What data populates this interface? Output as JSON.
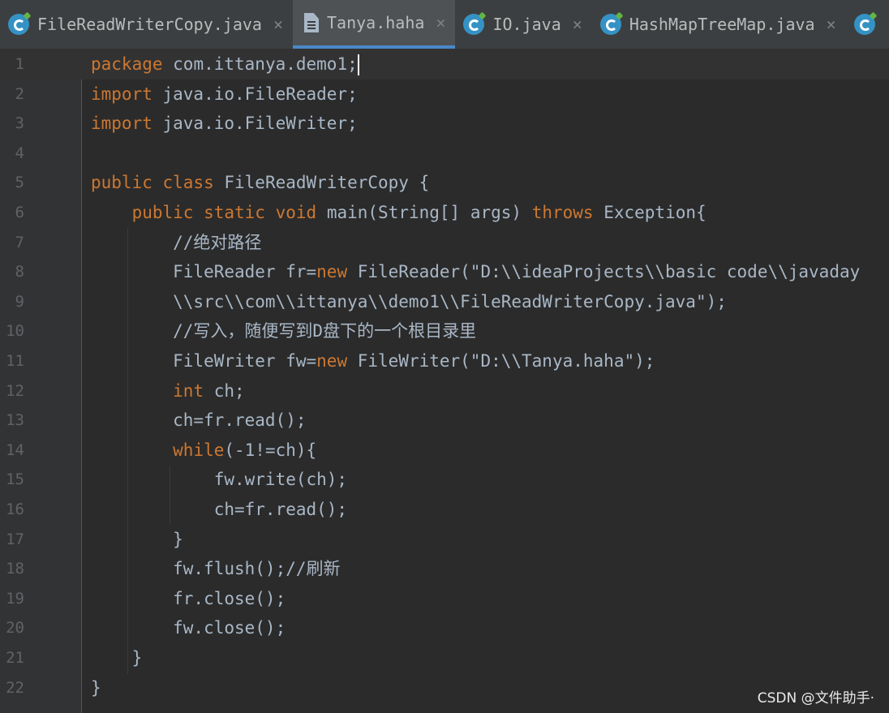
{
  "tabs": [
    {
      "label": "FileReadWriterCopy.java",
      "icon": "java-class-icon",
      "close": "×",
      "active": false
    },
    {
      "label": "Tanya.haha",
      "icon": "text-file-icon",
      "close": "×",
      "active": true
    },
    {
      "label": "IO.java",
      "icon": "java-class-icon",
      "close": "×",
      "active": false
    },
    {
      "label": "HashMapTreeMap.java",
      "icon": "java-class-icon",
      "close": "×",
      "active": false
    }
  ],
  "editor": {
    "lines": [
      {
        "n": "1",
        "text": "package com.ittanya.demo1;"
      },
      {
        "n": "2",
        "text": "import java.io.FileReader;"
      },
      {
        "n": "3",
        "text": "import java.io.FileWriter;"
      },
      {
        "n": "4",
        "text": ""
      },
      {
        "n": "5",
        "text": "public class FileReadWriterCopy {"
      },
      {
        "n": "6",
        "text": "    public static void main(String[] args) throws Exception{"
      },
      {
        "n": "7",
        "text": "        //绝对路径"
      },
      {
        "n": "8",
        "text": "        FileReader fr=new FileReader(\"D:\\\\ideaProjects\\\\basic code\\\\javaday"
      },
      {
        "n": "9",
        "text": "        \\\\src\\\\com\\\\ittanya\\\\demo1\\\\FileReadWriterCopy.java\");"
      },
      {
        "n": "10",
        "text": "        //写入，随便写到D盘下的一个根目录里"
      },
      {
        "n": "11",
        "text": "        FileWriter fw=new FileWriter(\"D:\\\\Tanya.haha\");"
      },
      {
        "n": "12",
        "text": "        int ch;"
      },
      {
        "n": "13",
        "text": "        ch=fr.read();"
      },
      {
        "n": "14",
        "text": "        while(-1!=ch){"
      },
      {
        "n": "15",
        "text": "            fw.write(ch);"
      },
      {
        "n": "16",
        "text": "            ch=fr.read();"
      },
      {
        "n": "17",
        "text": "        }"
      },
      {
        "n": "18",
        "text": "        fw.flush();//刷新"
      },
      {
        "n": "19",
        "text": "        fr.close();"
      },
      {
        "n": "20",
        "text": "        fw.close();"
      },
      {
        "n": "21",
        "text": "    }"
      },
      {
        "n": "22",
        "text": "}"
      }
    ],
    "current_line": "1"
  },
  "watermark": "CSDN @文件助手·",
  "colors": {
    "background": "#2b2b2b",
    "text": "#a9b7c6",
    "accent": "#4a88c7"
  }
}
